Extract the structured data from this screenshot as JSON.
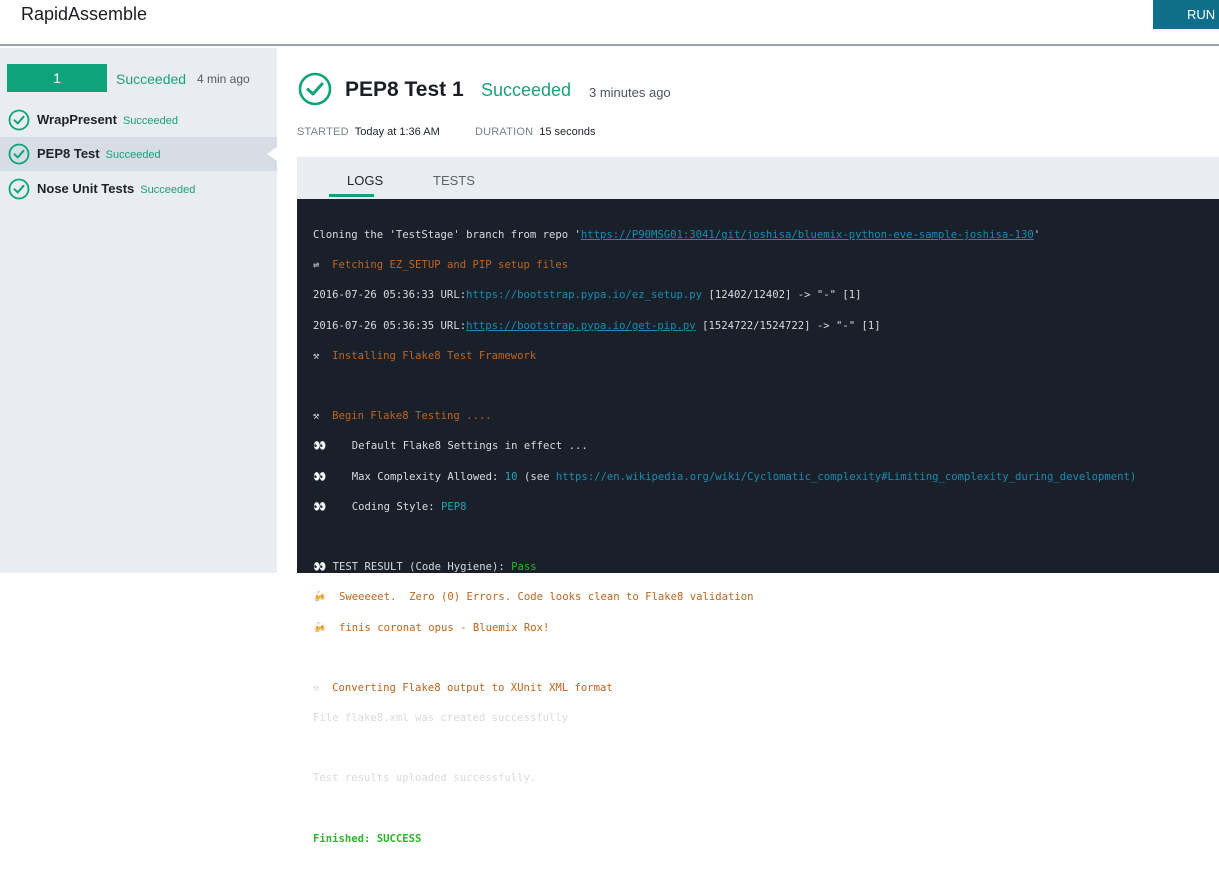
{
  "app": {
    "title": "RapidAssemble",
    "run_label": "RUN"
  },
  "sidebar": {
    "build": {
      "number": "1",
      "status": "Succeeded",
      "time": "4 min ago"
    },
    "stages": [
      {
        "name": "WrapPresent",
        "status": "Succeeded",
        "active": false
      },
      {
        "name": "PEP8 Test",
        "status": "Succeeded",
        "active": true
      },
      {
        "name": "Nose Unit Tests",
        "status": "Succeeded",
        "active": false
      }
    ]
  },
  "job": {
    "title": "PEP8 Test 1",
    "status": "Succeeded",
    "time_ago": "3 minutes ago",
    "started_label": "STARTED",
    "started_value": "Today at 1:36 AM",
    "duration_label": "DURATION",
    "duration_value": "15 seconds"
  },
  "tabs": [
    {
      "label": "LOGS",
      "active": true
    },
    {
      "label": "TESTS",
      "active": false
    }
  ],
  "colors": {
    "accent": "#0ea37b",
    "run_button": "#0f6e89",
    "log_bg": "#19202a",
    "log_orange": "#c3631b",
    "log_link": "#1b8bb0",
    "log_green": "#2bb52b"
  },
  "log": {
    "l1_pre": "Cloning the 'TestStage' branch from repo '",
    "l1_link": "https://P90MSG01:3041/git/joshisa/bluemix-python-eve-sample-joshisa-130",
    "l1_post": "'",
    "l2_icon": "⇌",
    "l2_text": "  Fetching EZ_SETUP and PIP setup files",
    "l3_pre": "2016-07-26 05:36:33 URL:",
    "l3_link": "https://bootstrap.pypa.io/ez_setup.py",
    "l3_post": " [12402/12402] -> \"-\" [1]",
    "l4_pre": "2016-07-26 05:36:35 URL:",
    "l4_link": "https://bootstrap.pypa.io/get-pip.py",
    "l4_post": " [1524722/1524722] -> \"-\" [1]",
    "l5_icon": "⚒",
    "l5_text": "  Installing Flake8 Test Framework",
    "l7_icon": "⚒",
    "l7_text": "  Begin Flake8 Testing ....",
    "l8_icon": "👀",
    "l8_text": "    Default Flake8 Settings in effect ...",
    "l9_icon": "👀",
    "l9_pre": "    Max Complexity Allowed: ",
    "l9_num": "10",
    "l9_mid": " (see ",
    "l9_link": "https://en.wikipedia.org/wiki/Cyclomatic_complexity#Limiting_complexity_during_development",
    "l9_post": ")",
    "l10_icon": "👀",
    "l10_pre": "    Coding Style: ",
    "l10_val": "PEP8",
    "l12_icon": "👀",
    "l12_pre": " TEST RESULT (Code Hygiene): ",
    "l12_val": "Pass",
    "l13_icon": "🍻",
    "l13_text": "  Sweeeeet.  Zero (0) Errors. Code looks clean to Flake8 validation",
    "l14_icon": "🍻",
    "l14_text": "  finis coronat opus - Bluemix Rox!",
    "l16_icon": "⚒",
    "l16_text": "  Converting Flake8 output to XUnit XML format",
    "l17_text": "File flake8.xml was created successfully",
    "l19_text": "Test results uploaded successfully.",
    "l21_text": "Finished: SUCCESS"
  }
}
